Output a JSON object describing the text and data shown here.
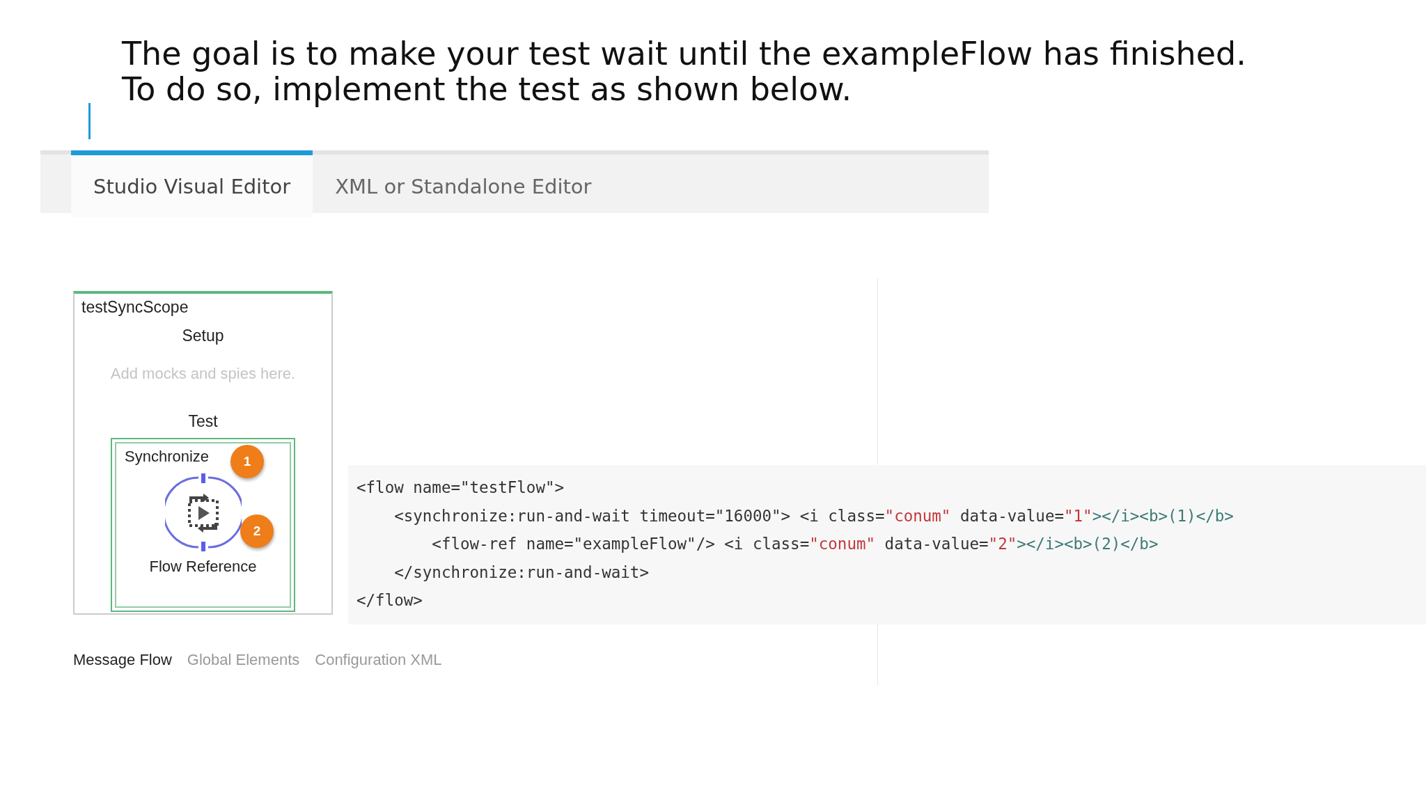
{
  "heading": {
    "lines": [
      "The goal is to make your test wait until the exampleFlow has finished.",
      "To do so, implement the test as shown below."
    ]
  },
  "tabs": [
    {
      "label": "Studio Visual Editor",
      "selected": true
    },
    {
      "label": "XML or Standalone Editor",
      "selected": false
    }
  ],
  "diagram": {
    "scope_title": "testSyncScope",
    "setup_label": "Setup",
    "setup_placeholder": "Add mocks and spies here.",
    "test_label": "Test",
    "sync_title": "Synchronize",
    "sync_badge": "1",
    "component_badge": "2",
    "component_label": "Flow Reference"
  },
  "code": [
    [
      {
        "kind": "plain",
        "text": "<flow name=\"testFlow\">"
      }
    ],
    [
      {
        "kind": "plain",
        "text": "    <synchronize:run-and-wait timeout=\"16000\"> <i class="
      },
      {
        "kind": "string",
        "text": "\"conum\""
      },
      {
        "kind": "plain",
        "text": " data-value="
      },
      {
        "kind": "string",
        "text": "\"1\""
      },
      {
        "kind": "tag",
        "text": "></i><b>(1)</b>"
      }
    ],
    [
      {
        "kind": "plain",
        "text": "        <flow-ref name=\"exampleFlow\"/> <i class="
      },
      {
        "kind": "string",
        "text": "\"conum\""
      },
      {
        "kind": "plain",
        "text": " data-value="
      },
      {
        "kind": "string",
        "text": "\"2\""
      },
      {
        "kind": "tag",
        "text": "></i><b>(2)</b>"
      }
    ],
    [
      {
        "kind": "plain",
        "text": "    </synchronize:run-and-wait>"
      }
    ],
    [
      {
        "kind": "plain",
        "text": "</flow>"
      }
    ]
  ],
  "view_tabs": [
    {
      "label": "Message Flow",
      "selected": true
    },
    {
      "label": "Global Elements",
      "selected": false
    },
    {
      "label": "Configuration XML",
      "selected": false
    }
  ]
}
